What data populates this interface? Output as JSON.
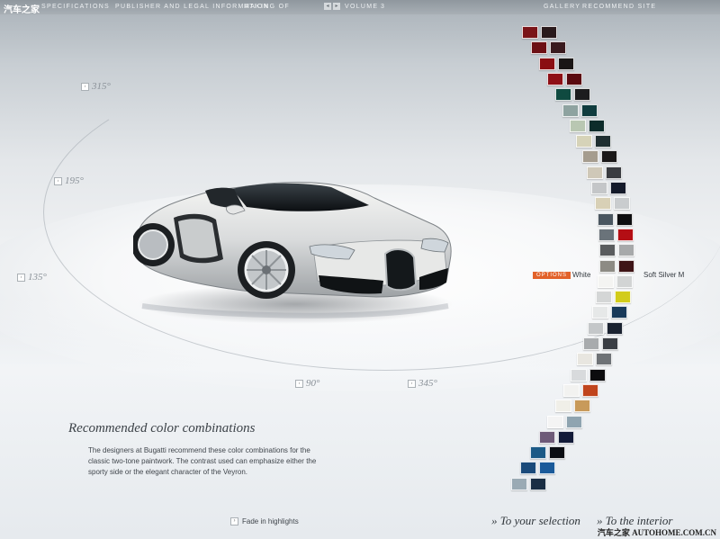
{
  "header": {
    "watermark": "汽车之家",
    "nav_left": [
      "SPECIFICATIONS",
      "PUBLISHER AND LEGAL INFORMATION",
      "MAKING OF"
    ],
    "volume_label": "VOLUME",
    "volume_value": "3",
    "nav_right": [
      "GALLERY",
      "RECOMMEND SITE"
    ]
  },
  "angles": [
    "315°",
    "195°",
    "135°",
    "90°",
    "345°"
  ],
  "section": {
    "title": "Recommended color combinations",
    "description": "The designers at Bugatti recommend these color combinations for the classic two-tone paintwork. The contrast used can emphasize either the sporty side or the elegant character of the Veyron."
  },
  "selection": {
    "options_badge": "OPTIONS",
    "color_left": "White",
    "color_right": "Soft Silver M"
  },
  "swatch_pairs": [
    [
      "#7a1418",
      "#2a1a1c"
    ],
    [
      "#6c0f14",
      "#3a1a1e"
    ],
    [
      "#8a0e12",
      "#1a1616"
    ],
    [
      "#8e1016",
      "#5a0a10"
    ],
    [
      "#0f4a40",
      "#1c1c1e"
    ],
    [
      "#8ea3a0",
      "#0f3c3e"
    ],
    [
      "#b9c7b2",
      "#0d2c2a"
    ],
    [
      "#d6d3b8",
      "#1e2e30"
    ],
    [
      "#a59c8e",
      "#1a1818"
    ],
    [
      "#cfc8b8",
      "#3a3c40"
    ],
    [
      "#c4c6c8",
      "#141a2a"
    ],
    [
      "#d8d0b6",
      "#c9ccce"
    ],
    [
      "#4a5660",
      "#0e0e10"
    ],
    [
      "#6a737a",
      "#b40e14"
    ],
    [
      "#5a5c5e",
      "#a7a9aa"
    ],
    [
      "#8d8b84",
      "#3e1416"
    ],
    [
      "#f4f4f2",
      "#d2d4d4"
    ],
    [
      "#d4d6d6",
      "#d2cc1a"
    ],
    [
      "#e6e8e8",
      "#183a5a"
    ],
    [
      "#c4c7c9",
      "#1a2230"
    ],
    [
      "#a8abad",
      "#3a3e44"
    ],
    [
      "#e8e6e0",
      "#6e7276"
    ],
    [
      "#d8dadc",
      "#0c0c0e"
    ],
    [
      "#f2f2f0",
      "#c0441c"
    ],
    [
      "#f0efe8",
      "#c89a5a"
    ],
    [
      "#f4f4f4",
      "#8fa4b0"
    ],
    [
      "#6e5a78",
      "#121a38"
    ],
    [
      "#1c5a86",
      "#0a0c12"
    ],
    [
      "#1a4a7a",
      "#1a5a9a"
    ],
    [
      "#9aaab4",
      "#1a2e44"
    ]
  ],
  "footer": {
    "fade_label": "Fade in highlights",
    "to_selection": "» To your selection",
    "to_interior": "» To the interior",
    "brand": "汽车之家  AUTOHOME.COM.CN"
  }
}
